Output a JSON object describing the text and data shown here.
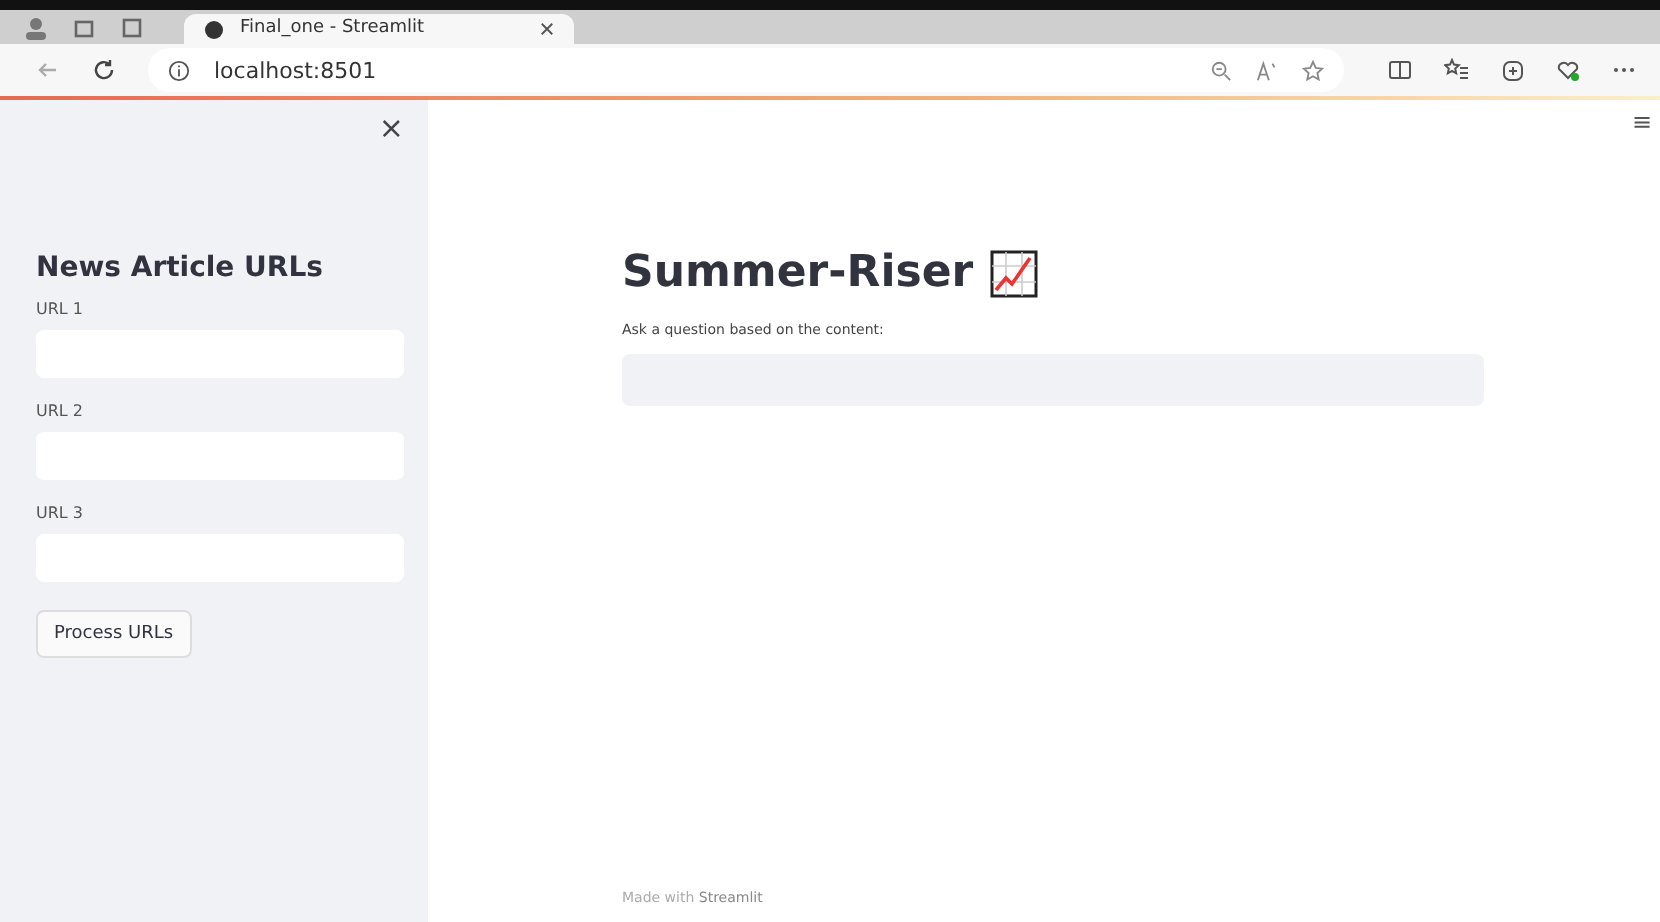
{
  "browser": {
    "tab_title": "Final_one - Streamlit",
    "address": "localhost:8501"
  },
  "sidebar": {
    "close": "×",
    "heading": "News Article URLs",
    "fields": [
      {
        "label": "URL 1"
      },
      {
        "label": "URL 2"
      },
      {
        "label": "URL 3"
      }
    ],
    "button": "Process URLs"
  },
  "main": {
    "title": "Summer-Riser",
    "question_label": "Ask a question based on the content:",
    "footer": "Made with **Streamlit**"
  },
  "menu": "≡"
}
